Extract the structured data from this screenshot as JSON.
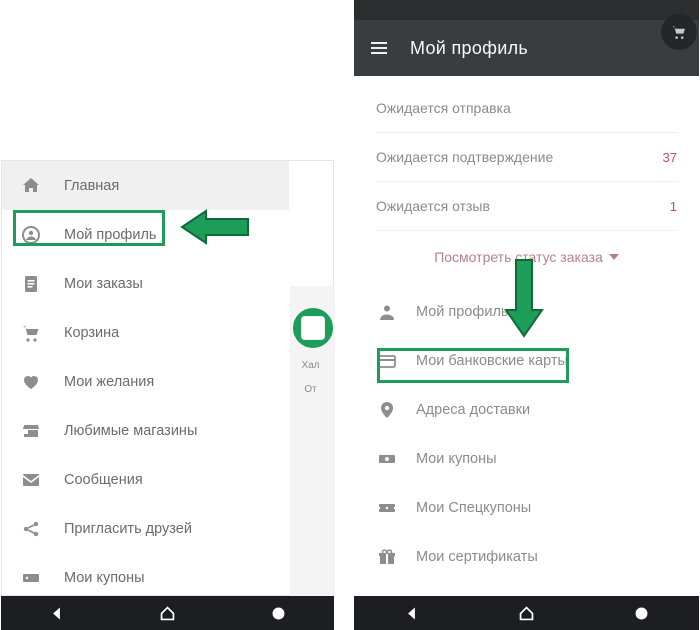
{
  "left": {
    "menu": [
      {
        "icon": "home",
        "label": "Главная"
      },
      {
        "icon": "profile",
        "label": "Мой профиль"
      },
      {
        "icon": "orders",
        "label": "Мои заказы"
      },
      {
        "icon": "cart",
        "label": "Корзина"
      },
      {
        "icon": "heart",
        "label": "Мои желания"
      },
      {
        "icon": "store",
        "label": "Любимые магазины"
      },
      {
        "icon": "mail",
        "label": "Сообщения"
      },
      {
        "icon": "share",
        "label": "Пригласить друзей"
      },
      {
        "icon": "coupon",
        "label": "Мои купоны"
      }
    ],
    "active_index": 0,
    "highlight_index": 1,
    "strip": {
      "line1": "Хал",
      "line2": "От"
    }
  },
  "right": {
    "header_title": "Мой профиль",
    "status": [
      {
        "label": "Ожидается отправка",
        "count": ""
      },
      {
        "label": "Ожидается подтверждение",
        "count": "37"
      },
      {
        "label": "Ожидается отзыв",
        "count": "1"
      }
    ],
    "status_link": "Посмотреть статус заказа",
    "profile_menu": [
      {
        "icon": "person",
        "label": "Мой профиль"
      },
      {
        "icon": "card",
        "label": "Мои банковские карты"
      },
      {
        "icon": "pin",
        "label": "Адреса доставки"
      },
      {
        "icon": "money",
        "label": "Мои купоны"
      },
      {
        "icon": "ticket",
        "label": "Мои Спецкупоны"
      },
      {
        "icon": "gift",
        "label": "Мои сертификаты"
      }
    ],
    "highlight_index": 1
  },
  "nav_buttons": [
    "back",
    "home",
    "recent"
  ],
  "colors": {
    "accent": "#1e9c5a",
    "accent_dark": "#0d6b38",
    "count": "#c94b59"
  }
}
